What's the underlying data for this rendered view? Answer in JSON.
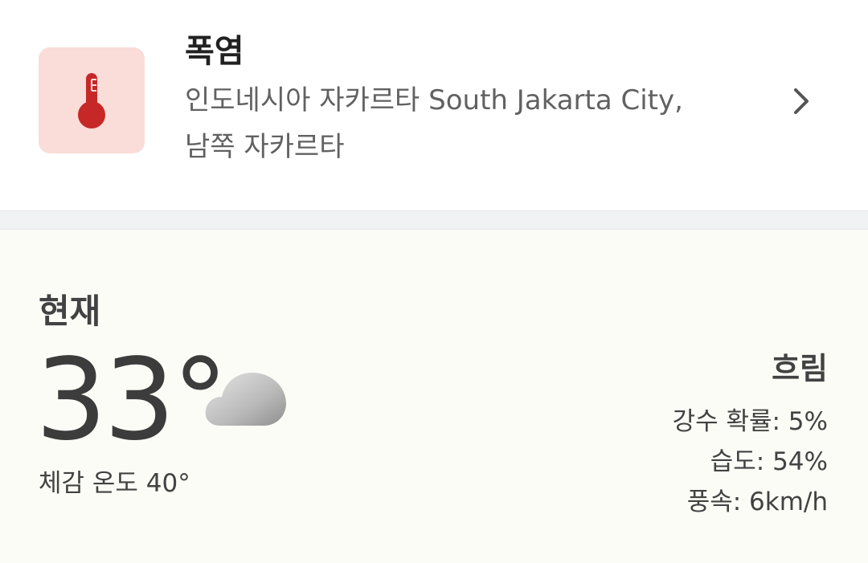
{
  "alert": {
    "title": "폭염",
    "location_line1": "인도네시아 자카르타 South Jakarta City,",
    "location_line2": "남쪽 자카르타",
    "icon": "thermometer-icon",
    "icon_bg_color": "#fadcd9",
    "icon_color": "#c62828"
  },
  "current": {
    "heading": "현재",
    "temperature": "33°",
    "feels_like": "체감 온도 40°",
    "condition": "흐림",
    "weather_icon": "cloud-icon",
    "details": [
      {
        "text": "강수 확률: 5%"
      },
      {
        "text": "습도: 54%"
      },
      {
        "text": "풍속: 6km/h"
      }
    ]
  }
}
